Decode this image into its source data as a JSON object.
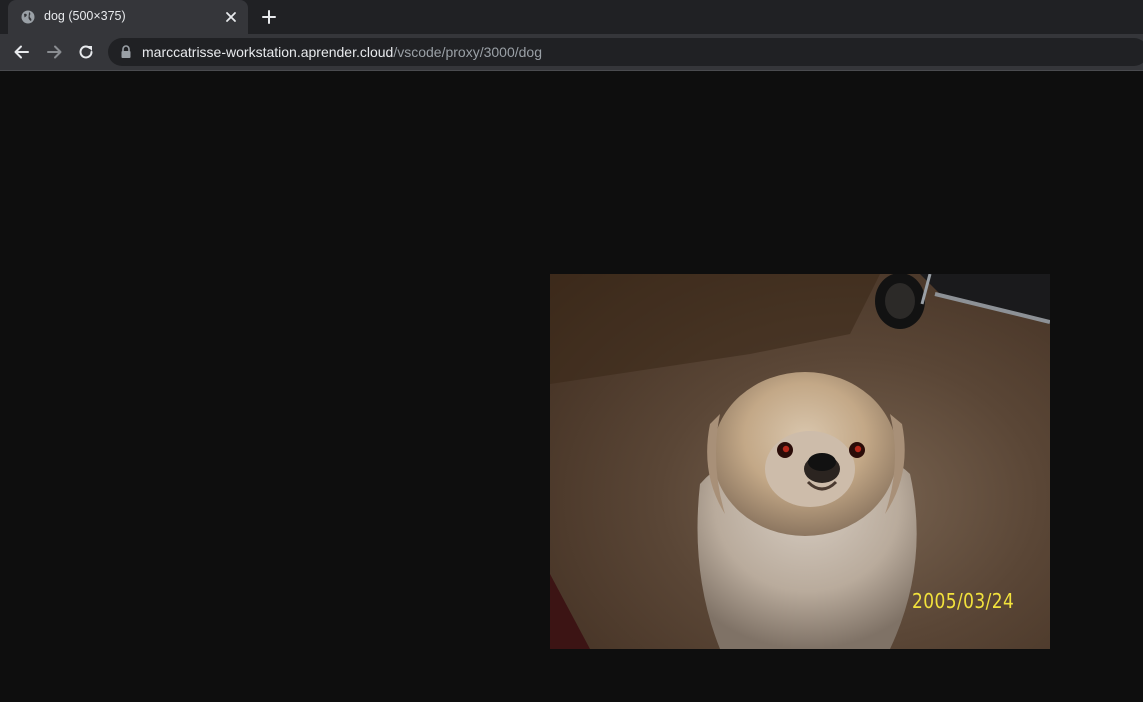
{
  "tab": {
    "title": "dog (500×375)",
    "favicon_icon": "globe-icon",
    "close_icon": "close-icon"
  },
  "tabstrip": {
    "new_tab_icon": "plus-icon"
  },
  "toolbar": {
    "back_icon": "arrow-left-icon",
    "forward_icon": "arrow-right-icon",
    "reload_icon": "reload-icon",
    "lock_icon": "lock-icon"
  },
  "address_bar": {
    "host": "marccatrisse-workstation.aprender.cloud",
    "path": "/vscode/proxy/3000/dog"
  },
  "image": {
    "date_stamp": "2005/03/24"
  },
  "colors": {
    "tabstrip_bg": "#202124",
    "tab_active_bg": "#35363a",
    "page_bg": "#0e0e0e",
    "date_stamp": "#f2e23c"
  }
}
